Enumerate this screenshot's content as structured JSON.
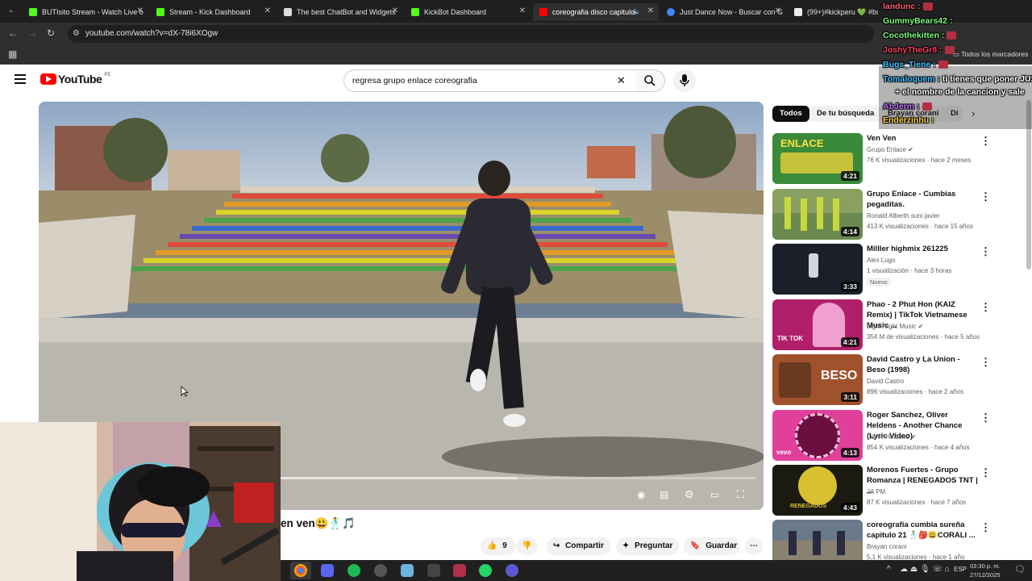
{
  "browser": {
    "tabs": [
      {
        "label": "BUTIsito Stream - Watch Live o",
        "color": "#53fc18"
      },
      {
        "label": "Stream - Kick Dashboard",
        "color": "#53fc18"
      },
      {
        "label": "The best ChatBot and Widgets",
        "color": "#ffffff"
      },
      {
        "label": "KickBot Dashboard",
        "color": "#53fc18"
      },
      {
        "label": "coreografia disco capitulo",
        "color": "#ff0000"
      },
      {
        "label": "Just Dance Now - Buscar con G",
        "color": "#4285f4"
      },
      {
        "label": "(99+)#kickperu 💚 #buti #bu",
        "color": "#ffffff"
      }
    ],
    "url": "youtube.com/watch?v=dX-78i6XOgw",
    "bookmarks_label": "Todos los marcadores"
  },
  "youtube": {
    "logo_text": "YouTube",
    "region": "PE",
    "search_value": "regresa grupo enlace coreografia",
    "video_title_visible": "en ven😃🕺🎵",
    "likes": "9",
    "actions": {
      "share": "Compartir",
      "ask": "Preguntar",
      "save": "Guardar"
    },
    "chips": [
      "Todos",
      "De tu búsqueda",
      "Brayan corani",
      "Di"
    ],
    "recommendations": [
      {
        "title": "Ven Ven",
        "channel": "Grupo Enlace",
        "verified": true,
        "meta": "76 K visualizaciones · hace 2 meses",
        "duration": "4:21",
        "thumb_color": "#3a8a3a",
        "thumb_text": "ENLACE"
      },
      {
        "title": "Grupo Enlace - Cumbias pegaditas.",
        "channel": "Ronald Alberth suni javier",
        "verified": false,
        "meta": "413 K visualizaciones · hace 15 años",
        "duration": "4:14",
        "thumb_color": "#8aa060",
        "thumb_text": ""
      },
      {
        "title": "Milller highmix 261225",
        "channel": "Alex Lugo",
        "verified": false,
        "meta": "1 visualización · hace 3 horas",
        "badge": "Nuevo",
        "duration": "3:33",
        "thumb_color": "#1a1f2a",
        "thumb_text": ""
      },
      {
        "title": "Phao - 2 Phut Hon (KAIZ Remix) | TikTok Vietnamese Music ...",
        "channel": "Light Night Music",
        "verified": true,
        "meta": "354 M de visualizaciones · hace 5 años",
        "duration": "4:21",
        "thumb_color": "#b0206a",
        "thumb_text": "TIK TOK"
      },
      {
        "title": "David Castro y La Union - Beso (1998)",
        "channel": "David Castro",
        "verified": false,
        "meta": "896 visualizaciones · hace 2 años",
        "duration": "3:11",
        "thumb_color": "#a0522d",
        "thumb_text": "BESO"
      },
      {
        "title": "Roger Sanchez, Oliver Heldens - Another Chance (Lyric Video)",
        "channel": "Oliver Heldens",
        "verified": true,
        "meta": "854 K visualizaciones · hace 4 años",
        "duration": "4:13",
        "thumb_color": "#e0409a",
        "thumb_text": "vevo"
      },
      {
        "title": "Morenos Fuertes - Grupo Romanza | RENEGADOS TNT | ...",
        "channel": "JA PM",
        "verified": false,
        "meta": "87 K visualizaciones · hace 7 años",
        "duration": "4:43",
        "thumb_color": "#1a1a10",
        "thumb_text": "RENEGADOS"
      },
      {
        "title": "coreografia cumbia sureña capitulo 21 🕺🎒😃CORALI ...",
        "channel": "Brayan corani",
        "verified": false,
        "meta": "5,1 K visualizaciones · hace 1 año",
        "duration": "",
        "thumb_color": "#6a7a8a",
        "thumb_text": ""
      }
    ]
  },
  "chat": [
    {
      "user": "landunc :",
      "color": "#ff6070"
    },
    {
      "user": "GummyBears42 :",
      "color": "#7cff7c"
    },
    {
      "user": "Cocothekitten :",
      "color": "#7cff7c"
    },
    {
      "user": "JoshyTheGr8 :",
      "color": "#ff4060"
    },
    {
      "user": "Bugs_Tiene :",
      "color": "#40c0ff"
    },
    {
      "user": "Tomaloquem :",
      "color": "#40c0ff",
      "message": "ti tienes que poner JUST"
    },
    {
      "user": "",
      "color": "#ffffff",
      "message": "+ el nombre de la cancion y sale"
    },
    {
      "user": "AbJerm :",
      "color": "#c070ff"
    },
    {
      "user": "Enderzinhu :",
      "color": "#ffd040"
    }
  ],
  "taskbar": {
    "time": "03:30 p. m.",
    "date": "27/12/2025",
    "lang": "ESP"
  }
}
